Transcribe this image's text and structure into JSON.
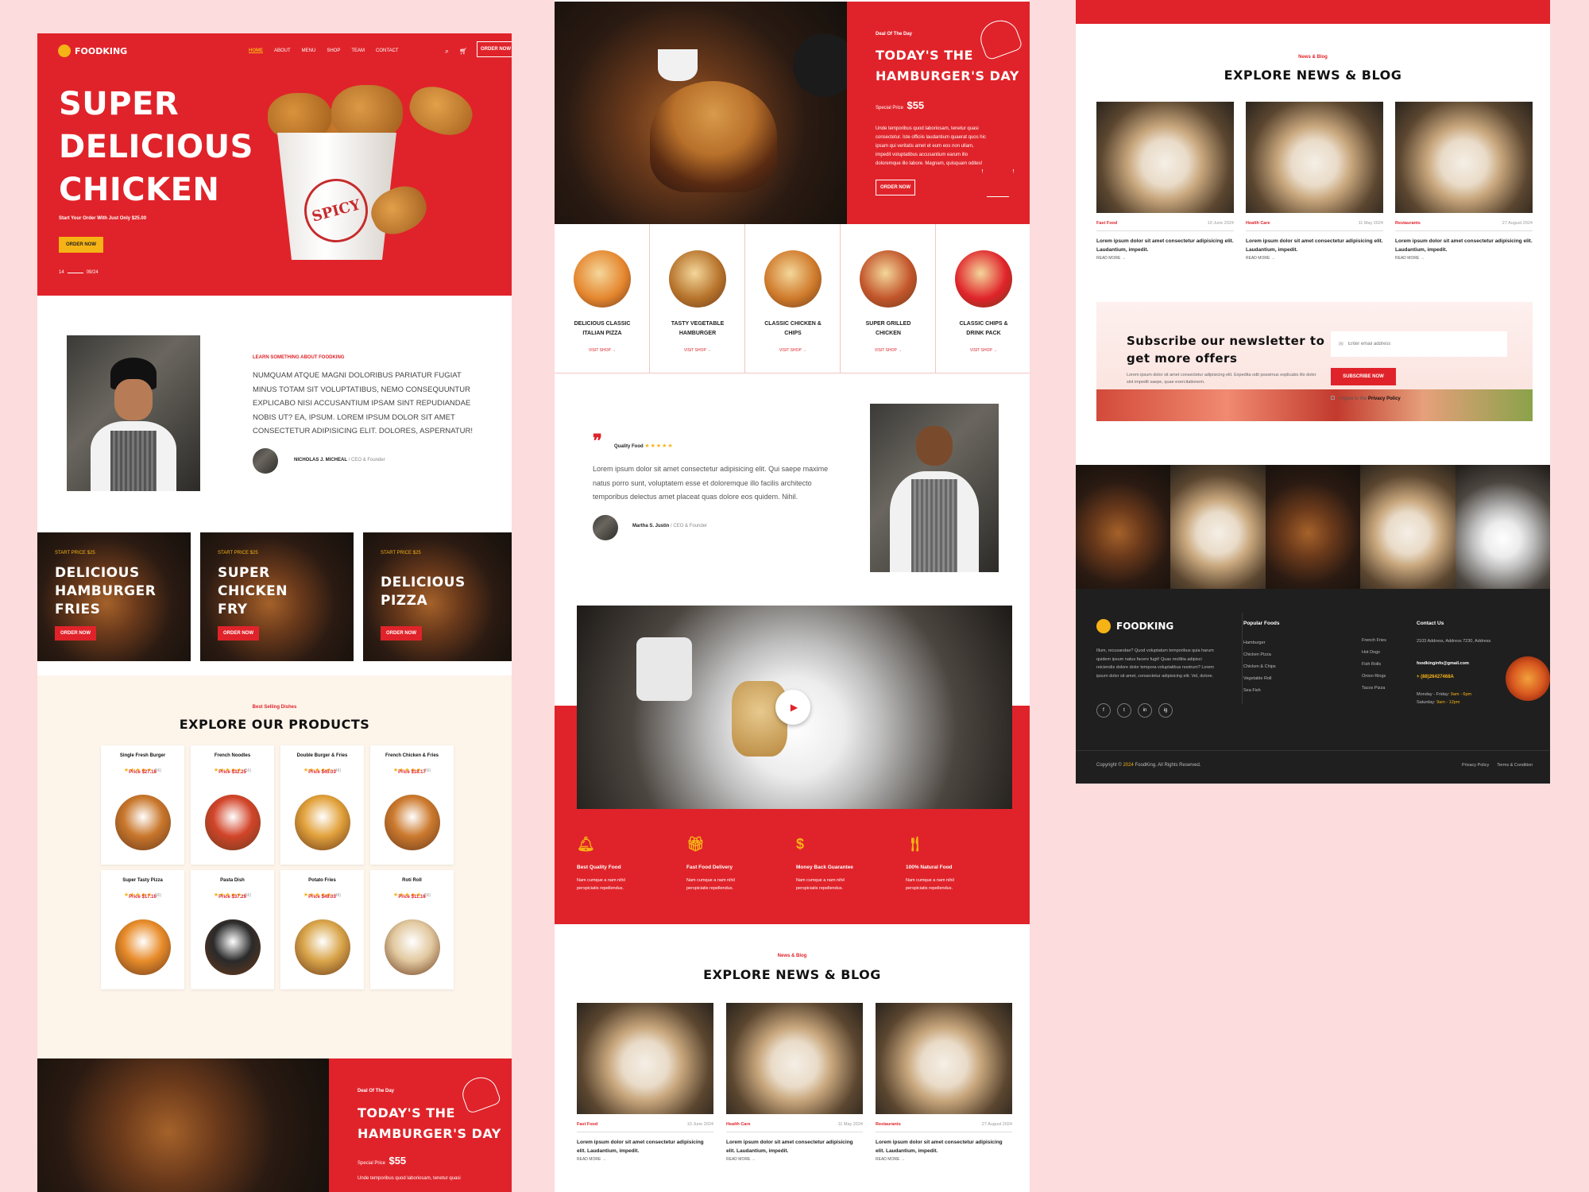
{
  "col1": {
    "logo": "FOODKING",
    "nav": [
      "HOME",
      "ABOUT",
      "MENU",
      "SHOP",
      "TEAM",
      "CONTACT"
    ],
    "nav_cta": "ORDER NOW",
    "hero": {
      "title": [
        "SUPER",
        "DELICIOUS",
        "CHICKEN"
      ],
      "subtitle": "Start Your Order With Just Only $25.00",
      "cta": "ORDER NOW",
      "slide_start": "14",
      "slide_end": "09/24",
      "bucket_text": "SPICY"
    },
    "about": {
      "eyebrow": "LEARN SOMETHING ABOUT FOODKING",
      "text": "NUMQUAM ATQUE MAGNI DOLORIBUS PARIATUR FUGIAT MINUS TOTAM SIT VOLUPTATIBUS, NEMO CONSEQUUNTUR EXPLICABO NISI ACCUSANTIUM IPSAM SINT REPUDIANDAE NOBIS UT? EA, IPSUM. LOREM IPSUM DOLOR SIT AMET CONSECTETUR ADIPISICING ELIT. DOLORES, ASPERNATUR!",
      "author": "NICHOLAS J. MICHEAL",
      "role": "CEO & Founder"
    },
    "promos": [
      {
        "price": "START PRICE $25",
        "title": [
          "DELICIOUS",
          "HAMBURGER",
          "FRIES"
        ],
        "cta": "ORDER NOW"
      },
      {
        "price": "START PRICE $25",
        "title": [
          "SUPER",
          "CHICKEN",
          "FRY"
        ],
        "cta": "ORDER NOW"
      },
      {
        "price": "START PRICE $25",
        "title": [
          "DELICIOUS",
          "PIZZA"
        ],
        "cta": "ORDER NOW"
      }
    ],
    "products": {
      "eyebrow": "Best Selling Dishes",
      "title": "EXPLORE OUR PRODUCTS",
      "items": [
        {
          "name": "Single Fresh Burger",
          "reviews": "(56)",
          "price": "Price $27.18"
        },
        {
          "name": "French Noodles",
          "reviews": "(56)",
          "price": "Price $32.25"
        },
        {
          "name": "Double Burger & Fries",
          "reviews": "(48)",
          "price": "Price $45.03"
        },
        {
          "name": "French Chicken & Fries",
          "reviews": "(56)",
          "price": "Price $18.17"
        },
        {
          "name": "Super Tasty Pizza",
          "reviews": "(36)",
          "price": "Price $17.10"
        },
        {
          "name": "Pasta Dish",
          "reviews": "(56)",
          "price": "Price $37.29"
        },
        {
          "name": "Potato Fries",
          "reviews": "(48)",
          "price": "Price $49.03"
        },
        {
          "name": "Roti Roll",
          "reviews": "(56)",
          "price": "Price $11.16"
        }
      ]
    },
    "deal": {
      "eyebrow": "Deal Of The Day",
      "title": [
        "TODAY'S THE",
        "HAMBURGER'S DAY"
      ],
      "price_label": "Special Price",
      "price": "$55",
      "text": "Unde temporibus quod laboriosam, tenetur quasi"
    }
  },
  "col2": {
    "deal": {
      "eyebrow": "Deal Of The Day",
      "title": [
        "TODAY'S THE",
        "HAMBURGER'S DAY"
      ],
      "price_label": "Special Price",
      "price": "$55",
      "text": "Unde temporibus quod laboriosam, tenetur quasi consectetur. Iste officiis laudantium quaerat quos hic ipsam qui veritatis amet et eum eos non ullam, impedit voluptatibus accusantium earum illo doloremque illo labore. Magnam, quisquam odites!",
      "cta": "ORDER NOW"
    },
    "categories": [
      {
        "name": [
          "DELICIOUS CLASSIC",
          "ITALIAN PIZZA"
        ],
        "link": "VISIT SHOP →"
      },
      {
        "name": [
          "TASTY VEGETABLE",
          "HAMBURGER"
        ],
        "link": "VISIT SHOP →"
      },
      {
        "name": [
          "CLASSIC CHICKEN &",
          "CHIPS"
        ],
        "link": "VISIT SHOP →"
      },
      {
        "name": [
          "SUPER GRILLED",
          "CHICKEN"
        ],
        "link": "VISIT SHOP →"
      },
      {
        "name": [
          "CLASSIC CHIPS &",
          "DRINK PACK"
        ],
        "link": "VISIT SHOP →"
      }
    ],
    "testimonial": {
      "label": "Quality Food",
      "text": "Lorem ipsum dolor sit amet consectetur adipisicing elit. Qui saepe maxime natus porro sunt, voluptatem esse et doloremque illo facilis architecto temporibus delectus amet placeat quas dolore eos quidem. Nihil.",
      "author": "Martha S. Justin",
      "role": "CEO & Founder"
    },
    "features": [
      {
        "title": "Best Quality Food",
        "text": "Nam cumque a nam nihil perspiciatis repellendus."
      },
      {
        "title": "Fast Food Delivery",
        "text": "Nam cumque a nam nihil perspiciatis repellendus."
      },
      {
        "title": "Money Back Guarantee",
        "text": "Nam cumque a nam nihil perspiciatis repellendus."
      },
      {
        "title": "100% Natural Food",
        "text": "Nam cumque a nam nihil perspiciatis repellendus."
      }
    ],
    "news": {
      "eyebrow": "News & Blog",
      "title": "EXPLORE NEWS & BLOG",
      "posts": [
        {
          "cat": "Fast Food",
          "date": "10 June 2024",
          "text": "Lorem ipsum dolor sit amet consectetur adipisicing elit. Laudantium, impedit.",
          "link": "READ MORE →"
        },
        {
          "cat": "Health Care",
          "date": "11 May 2024",
          "text": "Lorem ipsum dolor sit amet consectetur adipisicing elit. Laudantium, impedit.",
          "link": "READ MORE →"
        },
        {
          "cat": "Restaurants",
          "date": "27 August 2024",
          "text": "Lorem ipsum dolor sit amet consectetur adipisicing elit. Laudantium, impedit.",
          "link": "READ MORE →"
        }
      ]
    }
  },
  "col3": {
    "news": {
      "eyebrow": "News & Blog",
      "title": "EXPLORE NEWS & BLOG",
      "posts": [
        {
          "cat": "Fast Food",
          "date": "10 June 2024",
          "text": "Lorem ipsum dolor sit amet consectetur adipisicing elit. Laudantium, impedit.",
          "link": "READ MORE →"
        },
        {
          "cat": "Health Care",
          "date": "11 May 2024",
          "text": "Lorem ipsum dolor sit amet consectetur adipisicing elit. Laudantium, impedit.",
          "link": "READ MORE →"
        },
        {
          "cat": "Restaurants",
          "date": "27 August 2024",
          "text": "Lorem ipsum dolor sit amet consectetur adipisicing elit. Laudantium, impedit.",
          "link": "READ MORE →"
        }
      ]
    },
    "newsletter": {
      "title": [
        "Subscribe our newsletter to",
        "get more offers"
      ],
      "text": "Lorem ipsum dolor sit amet consectetur adipisicing elit. Expedita odit possimus explicabo illo dolor sint impedit saepe, quae exercitationem.",
      "placeholder": "Enter email address",
      "cta": "SUBSCRIBE NOW",
      "agree": "I Agree to the",
      "policy": "Privacy Policy"
    },
    "footer": {
      "logo": "FOODKING",
      "about": "Illum, recusandae? Quod voluptatum temporibus quia harum quidem ipsum natus facere fugit! Quas mollitia adipisci reiciendis dolore dolor tempora voluptatibus nostrum? Lorem ipsum dolor sit amet, consectetur adipisicing elit. Vel, dolore.",
      "social": [
        "f",
        "t",
        "in",
        "ig"
      ],
      "popular_title": "Popular Foods",
      "popular_a": [
        "Hamburger",
        "Chicken Pizza",
        "Chicken & Chips",
        "Vegetable Roll",
        "Sea Fish"
      ],
      "popular_b": [
        "French Fries",
        "Hot Dogs",
        "Fish Rolls",
        "Onion Rings",
        "Tacos Pizza"
      ],
      "contact_title": "Contact Us",
      "address": "2103 Address, Address 7230, Address",
      "email": "foodkinginfo@gmail.com",
      "phone": "+ (88)26427468A",
      "hours_1_label": "Monday - Friday:",
      "hours_1": "9am - 6pm",
      "hours_2_label": "Saturday:",
      "hours_2": "9am - 12pm",
      "copyright_pre": "Copyright ©",
      "copyright_year": "2024",
      "copyright_post": "FoodKing. All Rights Reserved.",
      "links": [
        "Privacy Policy",
        "Terms & Condition"
      ]
    }
  },
  "colors": {
    "red": "#e0232a",
    "yellow": "#f6b315",
    "dark": "#1f1f1f",
    "cream": "#fdf4ea",
    "background": "#fcdcdc"
  }
}
